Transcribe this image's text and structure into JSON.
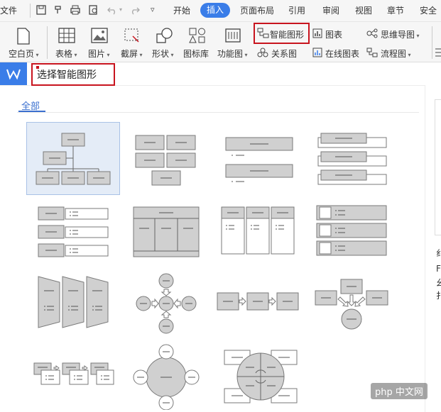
{
  "menu": {
    "file_label": "文件",
    "tabs": [
      "开始",
      "插入",
      "页面布局",
      "引用",
      "审阅",
      "视图",
      "章节",
      "安全"
    ],
    "active_tab": "插入"
  },
  "ribbon": {
    "blank_page": "空白页",
    "table": "表格",
    "picture": "图片",
    "screenshot": "截屏",
    "shape": "形状",
    "icon_library": "图标库",
    "function_chart": "功能图",
    "smart_art": "智能图形",
    "relation_chart": "关系图",
    "chart": "图表",
    "online_chart": "在线图表",
    "mind_map": "思维导图",
    "flow_chart": "流程图"
  },
  "panel": {
    "title": "选择智能图形",
    "category_tab": "全部"
  },
  "right_panel_chars": [
    "纟",
    "F",
    "幺",
    "扌"
  ],
  "watermark": "php 中文网",
  "colors": {
    "accent": "#3a7de8",
    "highlight_red": "#c8141e",
    "shape_fill": "#d0d0d0",
    "selected_bg": "#e4ecf7"
  }
}
